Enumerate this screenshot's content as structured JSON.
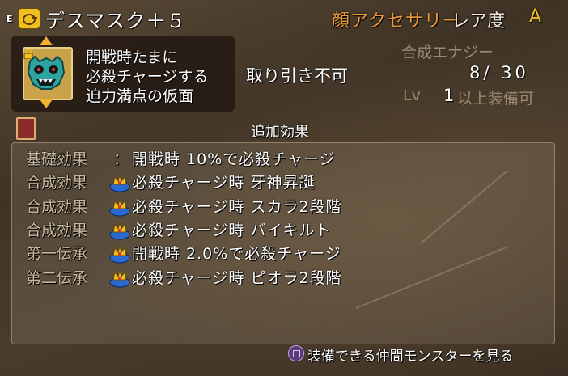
{
  "header": {
    "equip_marker": "E",
    "category_icon": "accessory-icon",
    "item_name": "デスマスク＋５",
    "category": "顔アクセサリー",
    "rarity_label": "レア度",
    "rarity_value": "A"
  },
  "description": {
    "item_icon": "death-mask-icon",
    "lock_icon": "lock-icon",
    "lines": [
      "開戦時たまに",
      "必殺チャージする",
      "迫力満点の仮面"
    ]
  },
  "info": {
    "trade": "取り引き不可",
    "energy_label": "合成エナジー",
    "energy_value": "8/ 30",
    "lv_label": "Lv",
    "lv_value": "1",
    "lv_suffix": "以上装備可"
  },
  "effects": {
    "section_icon": "book-icon",
    "title": "追加効果",
    "rows": [
      {
        "label": "基礎効果",
        "sep": "：",
        "text": "開戦時 10%で必殺チャージ",
        "badge": false
      },
      {
        "label": "合成効果",
        "sep": "",
        "text": "必殺チャージ時 牙神昇誕",
        "badge": true
      },
      {
        "label": "合成効果",
        "sep": "",
        "text": "必殺チャージ時 スカラ2段階",
        "badge": true
      },
      {
        "label": "合成効果",
        "sep": "",
        "text": "必殺チャージ時 バイキルト",
        "badge": true
      },
      {
        "label": "第一伝承",
        "sep": "",
        "text": "開戦時 2.0%で必殺チャージ",
        "badge": true
      },
      {
        "label": "第二伝承",
        "sep": "",
        "text": "必殺チャージ時 ピオラ2段階",
        "badge": true
      }
    ]
  },
  "footer": {
    "button_icon": "square-button-icon",
    "button_label": "装備できる仲間モンスターを見る"
  },
  "colors": {
    "category": "#e89a3a",
    "rarity": "#f0c020",
    "muted_label": "#9a8a72"
  }
}
